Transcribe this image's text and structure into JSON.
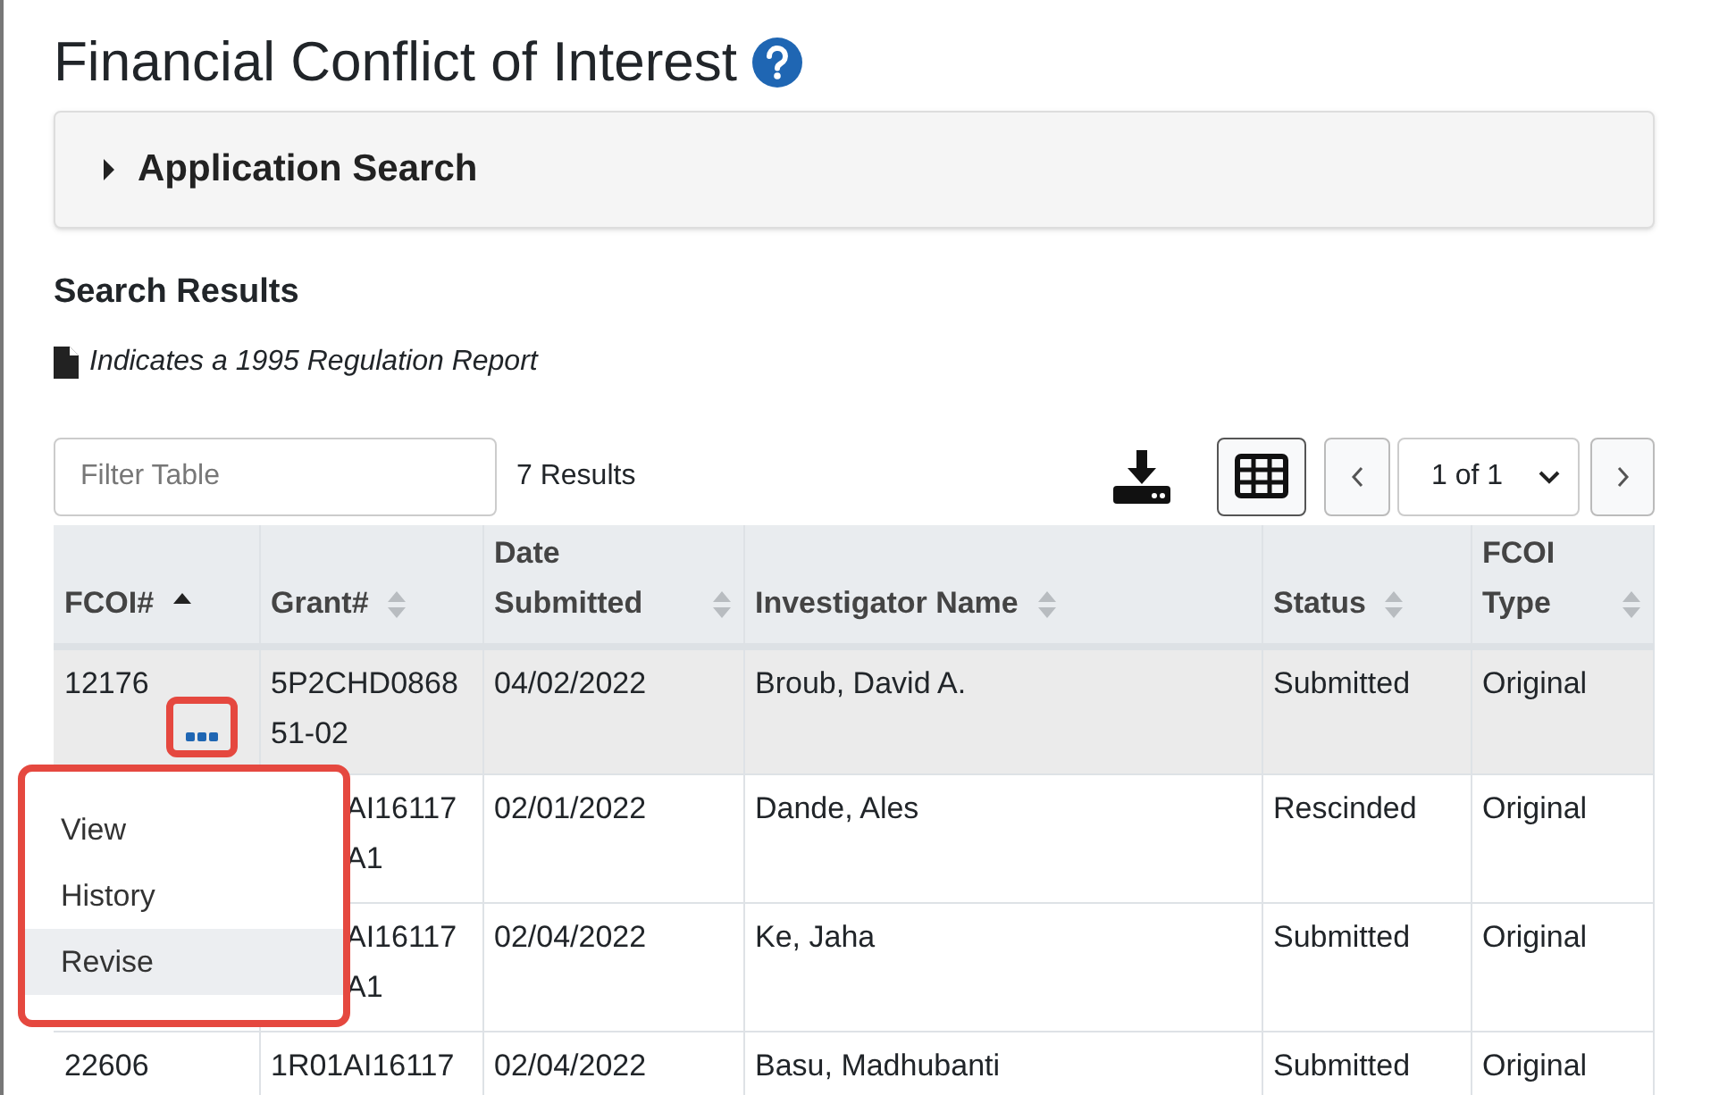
{
  "page": {
    "title": "Financial Conflict of Interest"
  },
  "search_panel": {
    "label": "Application Search",
    "expanded": false
  },
  "results": {
    "heading": "Search Results",
    "legend": "Indicates a 1995 Regulation Report"
  },
  "toolbar": {
    "filter_placeholder": "Filter Table",
    "count": "7 Results",
    "page_select": "1 of 1"
  },
  "table": {
    "columns": [
      {
        "label": "FCOI#",
        "sorted": true
      },
      {
        "label": "Grant#",
        "sorted": false
      },
      {
        "label": "Date Submitted",
        "sorted": false
      },
      {
        "label": "Investigator Name",
        "sorted": false
      },
      {
        "label": "Status",
        "sorted": false
      },
      {
        "label": "FCOI Type",
        "sorted": false
      }
    ],
    "rows": [
      {
        "selected": true,
        "covered": false,
        "cells": [
          "12176",
          "5P2CHD086851-02",
          "04/02/2022",
          "Broub, David A.",
          "Submitted",
          "Original"
        ]
      },
      {
        "selected": false,
        "covered": true,
        "cells": [
          "",
          "AI16117 A1",
          "02/01/2022",
          "Dande, Ales",
          "Rescinded",
          "Original"
        ]
      },
      {
        "selected": false,
        "covered": true,
        "cells": [
          "",
          "AI16117 A1",
          "02/04/2022",
          "Ke, Jaha",
          "Submitted",
          "Original"
        ]
      },
      {
        "selected": false,
        "covered": false,
        "cells": [
          "22606",
          "1R01AI16117",
          "02/04/2022",
          "Basu, Madhubanti",
          "Submitted",
          "Original"
        ]
      }
    ]
  },
  "row_menu": {
    "items": [
      {
        "label": "View",
        "selected": false
      },
      {
        "label": "History",
        "selected": false
      },
      {
        "label": "Revise",
        "selected": true
      }
    ]
  }
}
